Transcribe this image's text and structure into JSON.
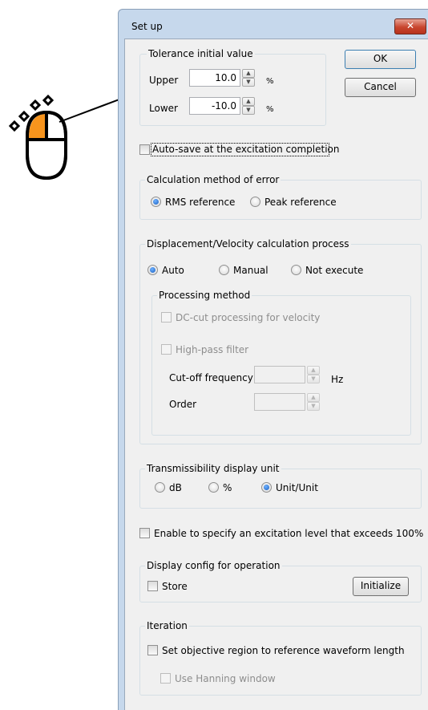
{
  "window": {
    "title": "Set up",
    "close_glyph": "✕"
  },
  "buttons": {
    "ok": "OK",
    "cancel": "Cancel",
    "initialize": "Initialize"
  },
  "tolerance": {
    "group_label": "Tolerance initial value",
    "upper_label": "Upper",
    "upper_value": "10.0",
    "upper_unit": "%",
    "lower_label": "Lower",
    "lower_value": "-10.0",
    "lower_unit": "%"
  },
  "autosave": {
    "label": "Auto-save at the excitation completion",
    "checked": false
  },
  "calc_error": {
    "group_label": "Calculation method of error",
    "options": [
      "RMS reference",
      "Peak reference"
    ],
    "selected": "RMS reference"
  },
  "disp_vel": {
    "group_label": "Displacement/Velocity calculation process",
    "options": [
      "Auto",
      "Manual",
      "Not execute"
    ],
    "selected": "Auto",
    "processing": {
      "group_label": "Processing method",
      "dc_cut_label": "DC-cut processing for velocity",
      "high_pass_label": "High-pass filter",
      "cutoff_label": "Cut-off frequency",
      "cutoff_unit": "Hz",
      "order_label": "Order"
    }
  },
  "transmissibility": {
    "group_label": "Transmissibility display unit",
    "options": [
      "dB",
      "%",
      "Unit/Unit"
    ],
    "selected": "Unit/Unit"
  },
  "excitation_level": {
    "label": "Enable to specify an excitation level that exceeds 100%",
    "checked": false
  },
  "display_config": {
    "group_label": "Display config for operation",
    "store_label": "Store"
  },
  "iteration": {
    "group_label": "Iteration",
    "objective_label": "Set objective region to reference waveform length",
    "hanning_label": "Use Hanning window"
  },
  "spin_glyphs": {
    "up": "▲",
    "down": "▼"
  },
  "colors": {
    "mouse_button": "#f7941d",
    "close_button": "#c8452e",
    "radio_selected": "#1a5fc0"
  },
  "annotation": {
    "icon": "mouse-left-click-icon",
    "arrow": "pointer-arrow"
  }
}
